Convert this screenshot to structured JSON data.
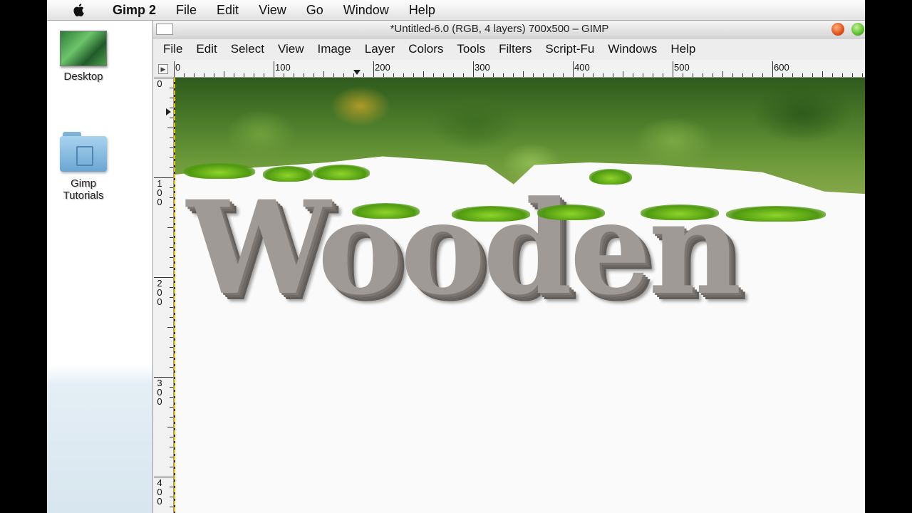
{
  "mac_menubar": {
    "app_name": "Gimp 2",
    "items": [
      "File",
      "Edit",
      "View",
      "Go",
      "Window",
      "Help"
    ]
  },
  "desktop": {
    "icons": [
      {
        "label": "Desktop"
      },
      {
        "label": "Gimp Tutorials"
      }
    ]
  },
  "gimp_window": {
    "title": "*Untitled-6.0 (RGB, 4 layers) 700x500 – GIMP",
    "menu": [
      "File",
      "Edit",
      "Select",
      "View",
      "Image",
      "Layer",
      "Colors",
      "Tools",
      "Filters",
      "Script-Fu",
      "Windows",
      "Help"
    ],
    "hruler_labels": [
      "0",
      "100",
      "200",
      "300",
      "400",
      "500",
      "600"
    ],
    "vruler_labels": [
      "0",
      "100",
      "200",
      "300",
      "400"
    ]
  },
  "canvas": {
    "text": "Wooden"
  },
  "colors": {
    "guide": "#e6c500",
    "grass": "#6cb81e",
    "wood": "#a09a96"
  }
}
